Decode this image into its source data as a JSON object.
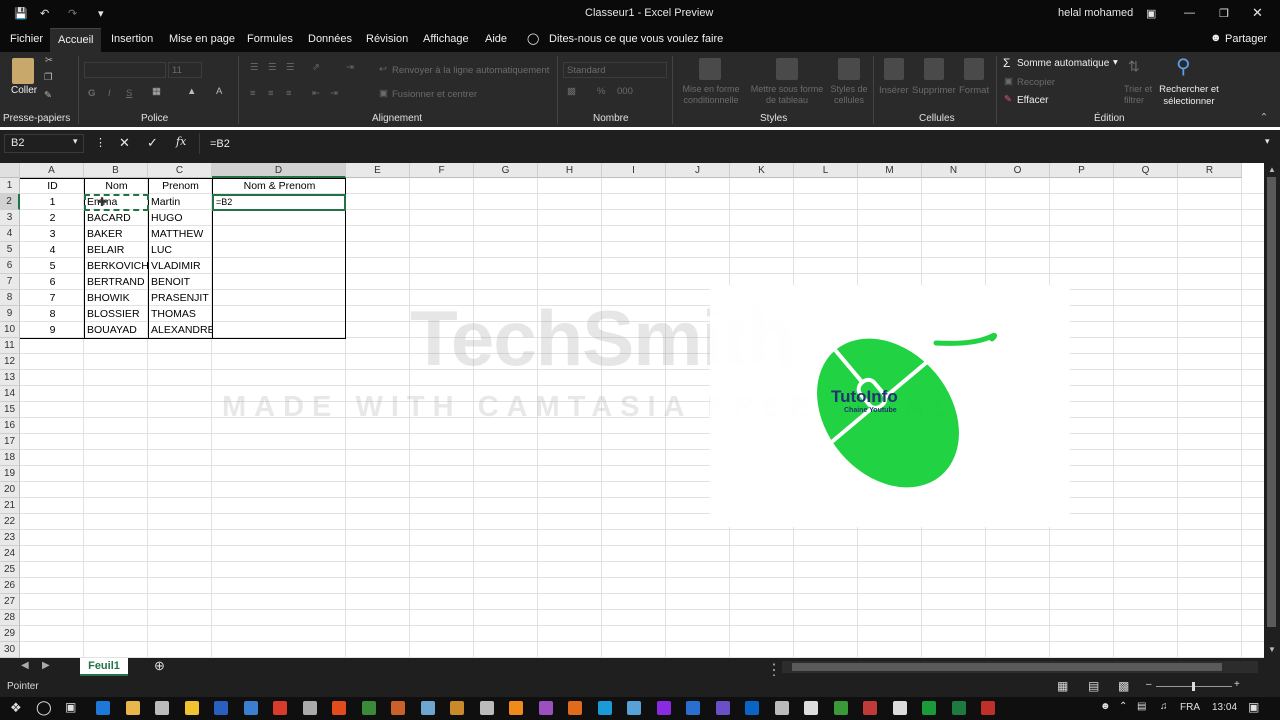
{
  "titlebar": {
    "doc_title": "Classeur1 - Excel Preview",
    "user": "helal mohamed"
  },
  "menu": {
    "tabs": [
      "Fichier",
      "Accueil",
      "Insertion",
      "Mise en page",
      "Formules",
      "Données",
      "Révision",
      "Affichage",
      "Aide"
    ],
    "tell_me": "Dites-nous ce que vous voulez faire",
    "share": "Partager"
  },
  "ribbon": {
    "paste_label": "Coller",
    "font_size": "11",
    "wrap_text": "Renvoyer à la ligne automatiquement",
    "merge": "Fusionner et centrer",
    "number_format": "Standard",
    "cond_format": "Mise en forme conditionnelle",
    "format_table": "Mettre sous forme de tableau",
    "cell_styles": "Styles de cellules",
    "insert": "Insérer",
    "delete": "Supprimer",
    "format": "Format",
    "autosum": "Somme automatique",
    "fill": "Recopier",
    "clear": "Effacer",
    "sort_filter": "Trier et filtrer",
    "find_select": "Rechercher et sélectionner",
    "groups": [
      "Presse-papiers",
      "Police",
      "Alignement",
      "Nombre",
      "Styles",
      "Cellules",
      "Édition"
    ]
  },
  "formula_bar": {
    "name_box": "B2",
    "formula": "=B2"
  },
  "sheet": {
    "columns": [
      "A",
      "B",
      "C",
      "D",
      "E",
      "F",
      "G",
      "H",
      "I",
      "J",
      "K",
      "L",
      "M",
      "N",
      "O",
      "P",
      "Q",
      "R"
    ],
    "header_row": [
      "ID",
      "Nom",
      "Prenom",
      "Nom & Prenom"
    ],
    "rows": [
      [
        "1",
        "Emma",
        "Martin"
      ],
      [
        "2",
        "BACARD",
        "HUGO"
      ],
      [
        "3",
        "BAKER",
        "MATTHEW"
      ],
      [
        "4",
        "BELAIR",
        "LUC"
      ],
      [
        "5",
        "BERKOVICH",
        "VLADIMIR"
      ],
      [
        "6",
        "BERTRAND",
        "BENOIT"
      ],
      [
        "7",
        "BHOWIK",
        "PRASENJIT"
      ],
      [
        "8",
        "BLOSSIER",
        "THOMAS"
      ],
      [
        "9",
        "BOUAYAD",
        "ALEXANDRE"
      ]
    ],
    "editing_cell_text": "=B2",
    "row_count": 30
  },
  "sheet_tabs": {
    "active": "Feuil1"
  },
  "status": {
    "mode": "Pointer"
  },
  "watermark": {
    "brand": "TechSmith",
    "line": "MADE WITH CAMTASIA FREE TRIAL"
  },
  "logo": {
    "name": "TutoInfo",
    "sub": "Chaine Youtube"
  },
  "taskbar": {
    "lang": "FRA",
    "time": "13:04"
  },
  "colors": {
    "excel_green": "#217346",
    "logo_green": "#19d13c",
    "dark_bg": "#0a0a0a"
  }
}
